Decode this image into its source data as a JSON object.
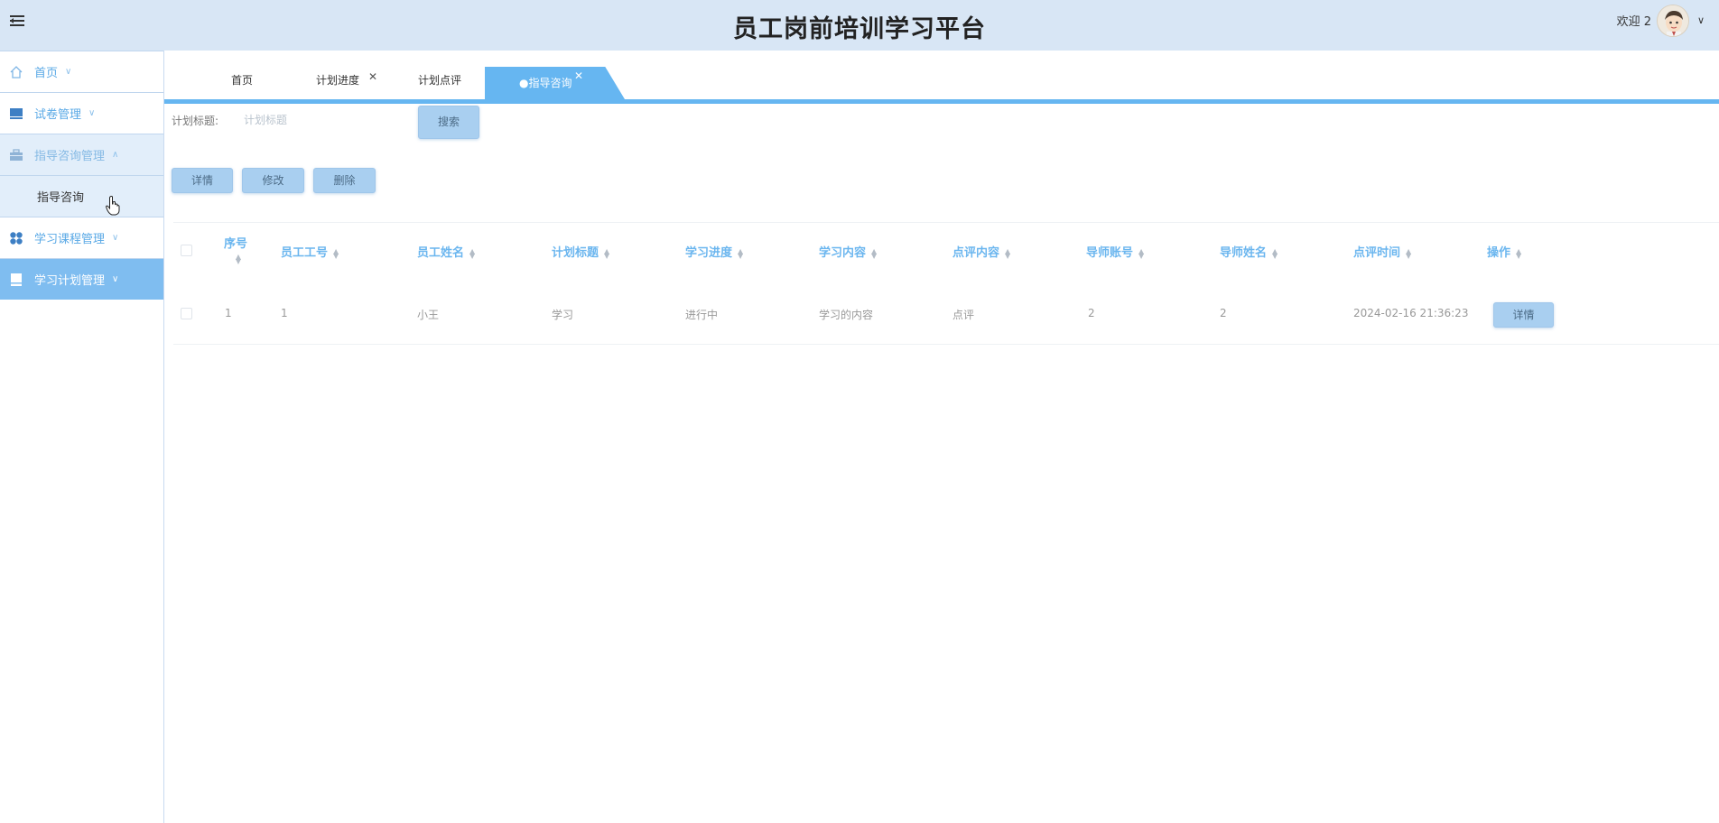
{
  "header": {
    "title": "员工岗前培训学习平台",
    "welcome": "欢迎 2"
  },
  "sidebar": {
    "items": [
      {
        "label": "首页",
        "icon": "home-icon"
      },
      {
        "label": "试卷管理",
        "icon": "monitor-icon"
      },
      {
        "label": "指导咨询管理",
        "icon": "briefcase-icon",
        "submenu": [
          {
            "label": "指导咨询"
          }
        ]
      },
      {
        "label": "学习课程管理",
        "icon": "grid-icon"
      },
      {
        "label": "学习计划管理",
        "icon": "book-icon"
      }
    ]
  },
  "tabs": [
    {
      "label": "首页"
    },
    {
      "label": "计划进度",
      "x": "✕"
    },
    {
      "label": "计划点评"
    },
    {
      "label": "●指导咨询",
      "x": "✕"
    }
  ],
  "search": {
    "label": "计划标题:",
    "placeholder": "计划标题",
    "button": "搜索"
  },
  "actions": {
    "detail": "详情",
    "edit": "修改",
    "delete": "删除"
  },
  "table": {
    "columns": [
      "序号",
      "员工工号",
      "员工姓名",
      "计划标题",
      "学习进度",
      "学习内容",
      "点评内容",
      "导师账号",
      "导师姓名",
      "点评时间",
      "操作"
    ],
    "rows": [
      {
        "cells": [
          "1",
          "1",
          "小王",
          "学习",
          "进行中",
          "学习的内容",
          "点评",
          "2",
          "2",
          "2024-02-16 21:36:23"
        ],
        "action": "详情"
      }
    ]
  },
  "colors": {
    "topbar": "#d8e6f5",
    "accent": "#66b6f1",
    "sidebar_active": "#7fbdf0",
    "button": "#a9cff0",
    "header_text": "#6bb6ef"
  }
}
